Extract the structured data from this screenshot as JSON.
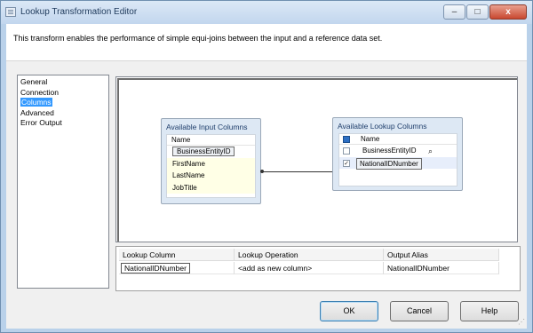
{
  "window": {
    "title": "Lookup Transformation Editor",
    "minimize_glyph": "–",
    "maximize_glyph": "□",
    "close_glyph": "x"
  },
  "description": "This transform enables the performance of simple equi-joins between the input and a reference data set.",
  "nav": {
    "items": [
      {
        "label": "General"
      },
      {
        "label": "Connection"
      },
      {
        "label": "Columns",
        "selected": true
      },
      {
        "label": "Advanced"
      },
      {
        "label": "Error Output"
      }
    ]
  },
  "input_columns": {
    "title": "Available Input Columns",
    "header": "Name",
    "rows": [
      "BusinessEntityID",
      "FirstName",
      "LastName",
      "JobTitle"
    ]
  },
  "lookup_columns": {
    "title": "Available Lookup Columns",
    "header": "Name",
    "rows": [
      {
        "label": "BusinessEntityID",
        "checked": false,
        "check_glyph": ""
      },
      {
        "label": "NationalIDNumber",
        "checked": true,
        "check_glyph": "✓"
      }
    ],
    "search_icon": "magnifier-icon"
  },
  "grid": {
    "headers": [
      "Lookup Column",
      "Lookup Operation",
      "Output Alias"
    ],
    "rows": [
      [
        "NationalIDNumber",
        "<add as new column>",
        "NationalIDNumber"
      ]
    ]
  },
  "buttons": {
    "ok": "OK",
    "cancel": "Cancel",
    "help": "Help"
  },
  "colors": {
    "titlebar": "#c2d6ee",
    "selection": "#3399ff",
    "column_box": "#dde8f4"
  }
}
